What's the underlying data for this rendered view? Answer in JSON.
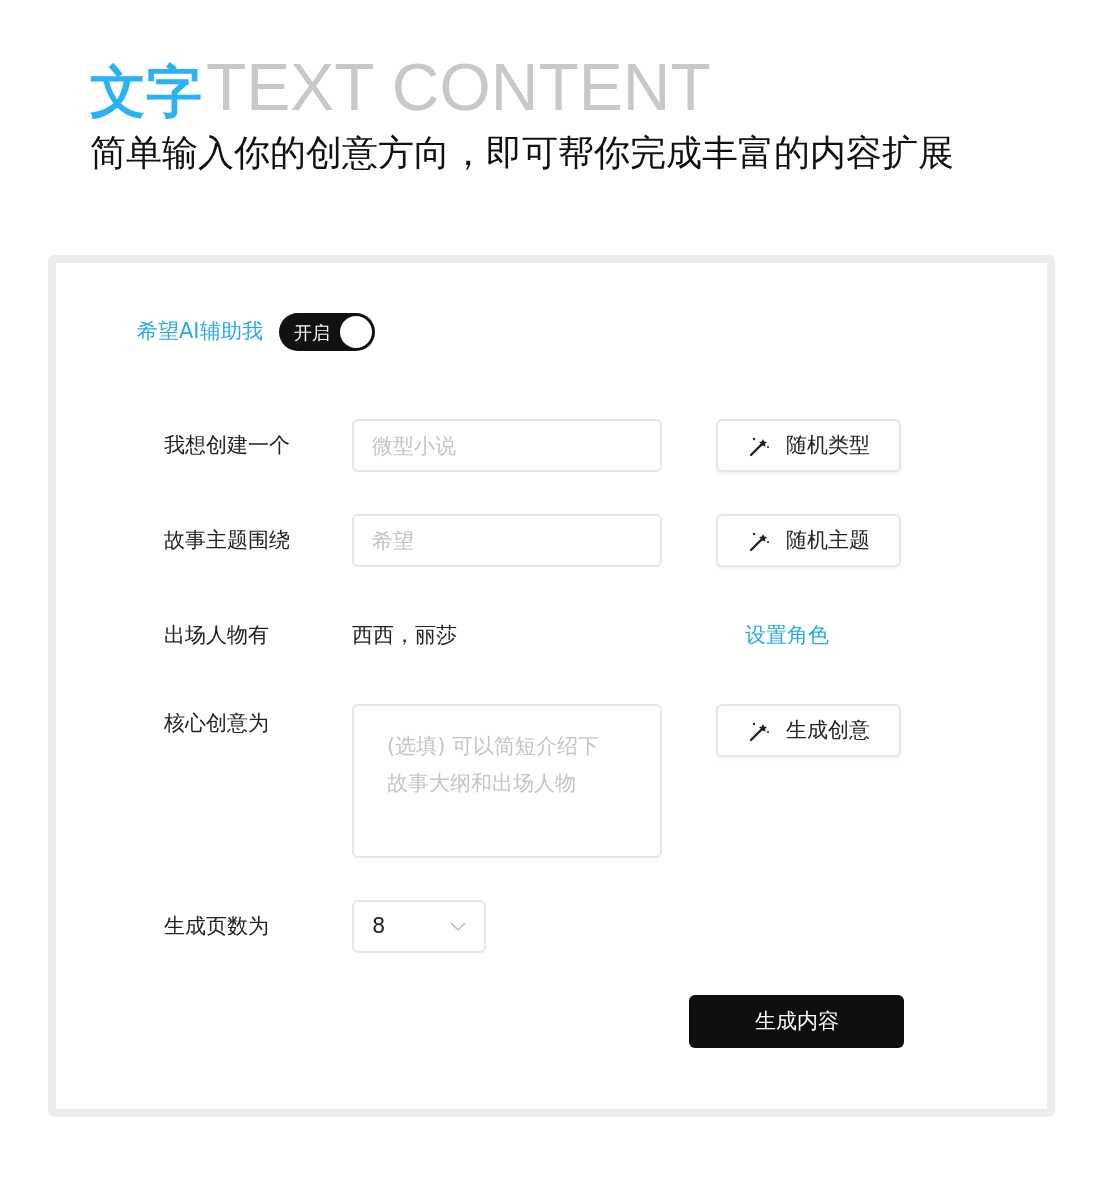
{
  "header": {
    "title": "文字",
    "ghost_title": "TEXT CONTENT",
    "subtitle": "简单输入你的创意方向，即可帮你完成丰富的内容扩展"
  },
  "ai_toggle": {
    "label": "希望AI辅助我",
    "on": true,
    "state_text": "开启"
  },
  "rows": [
    {
      "kind": "input",
      "label": "我想创建一个",
      "placeholder": "微型小说",
      "action": "随机类型"
    },
    {
      "kind": "input",
      "label": "故事主题围绕",
      "placeholder": "希望",
      "action": "随机主题"
    },
    {
      "kind": "text",
      "label": "出场人物有",
      "value": "西西，丽莎",
      "link": "设置角色"
    },
    {
      "kind": "textarea",
      "label": "核心创意为",
      "placeholder": "(选填) 可以简短介绍下故事大纲和出场人物",
      "action": "生成创意"
    },
    {
      "kind": "select",
      "label": "生成页数为",
      "value": "8"
    }
  ],
  "submit": "生成内容"
}
